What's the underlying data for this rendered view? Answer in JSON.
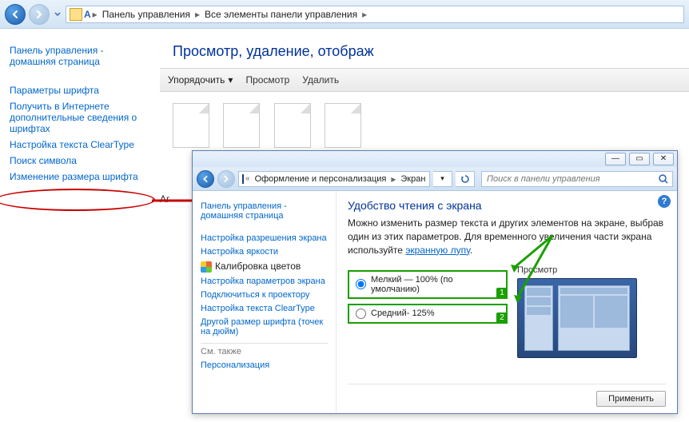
{
  "back": {
    "breadcrumb": [
      "Панель управления",
      "Все элементы панели управления"
    ],
    "sidebar": {
      "home": "Панель управления - домашняя страница",
      "items": [
        "Параметры шрифта",
        "Получить в Интернете дополнительные сведения о шрифтах",
        "Настройка текста ClearType",
        "Поиск символа",
        "Изменение размера шрифта"
      ]
    },
    "title": "Просмотр, удаление, отображ",
    "toolbar": {
      "organize": "Упорядочить",
      "view": "Просмотр",
      "delete": "Удалить"
    },
    "content_trunc": "Аг"
  },
  "front": {
    "breadcrumb": [
      "Оформление и персонализация",
      "Экран"
    ],
    "search_placeholder": "Поиск в панели управления",
    "help_glyph": "?",
    "sidebar": {
      "home": "Панель управления - домашняя страница",
      "items": [
        "Настройка разрешения экрана",
        "Настройка яркости",
        "Калибровка цветов",
        "Настройка параметров экрана",
        "Подключиться к проектору",
        "Настройка текста ClearType",
        "Другой размер шрифта (точек на дюйм)"
      ],
      "see_also_label": "См. также",
      "see_also": [
        "Персонализация"
      ]
    },
    "heading": "Удобство чтения с экрана",
    "description_pre": "Можно изменить размер текста и других элементов на экране, выбрав один из этих параметров. Для временного увеличения части экрана используйте ",
    "description_link": "экранную лупу",
    "description_post": ".",
    "options": [
      {
        "label": "Мелкий — 100% (по умолчанию)",
        "checked": true,
        "num": "1"
      },
      {
        "label": "Средний- 125%",
        "checked": false,
        "num": "2"
      }
    ],
    "preview_label": "Просмотр",
    "apply": "Применить"
  },
  "annotations": {
    "arrow_color_red": "#c80000",
    "arrow_color_green": "#19a000"
  }
}
